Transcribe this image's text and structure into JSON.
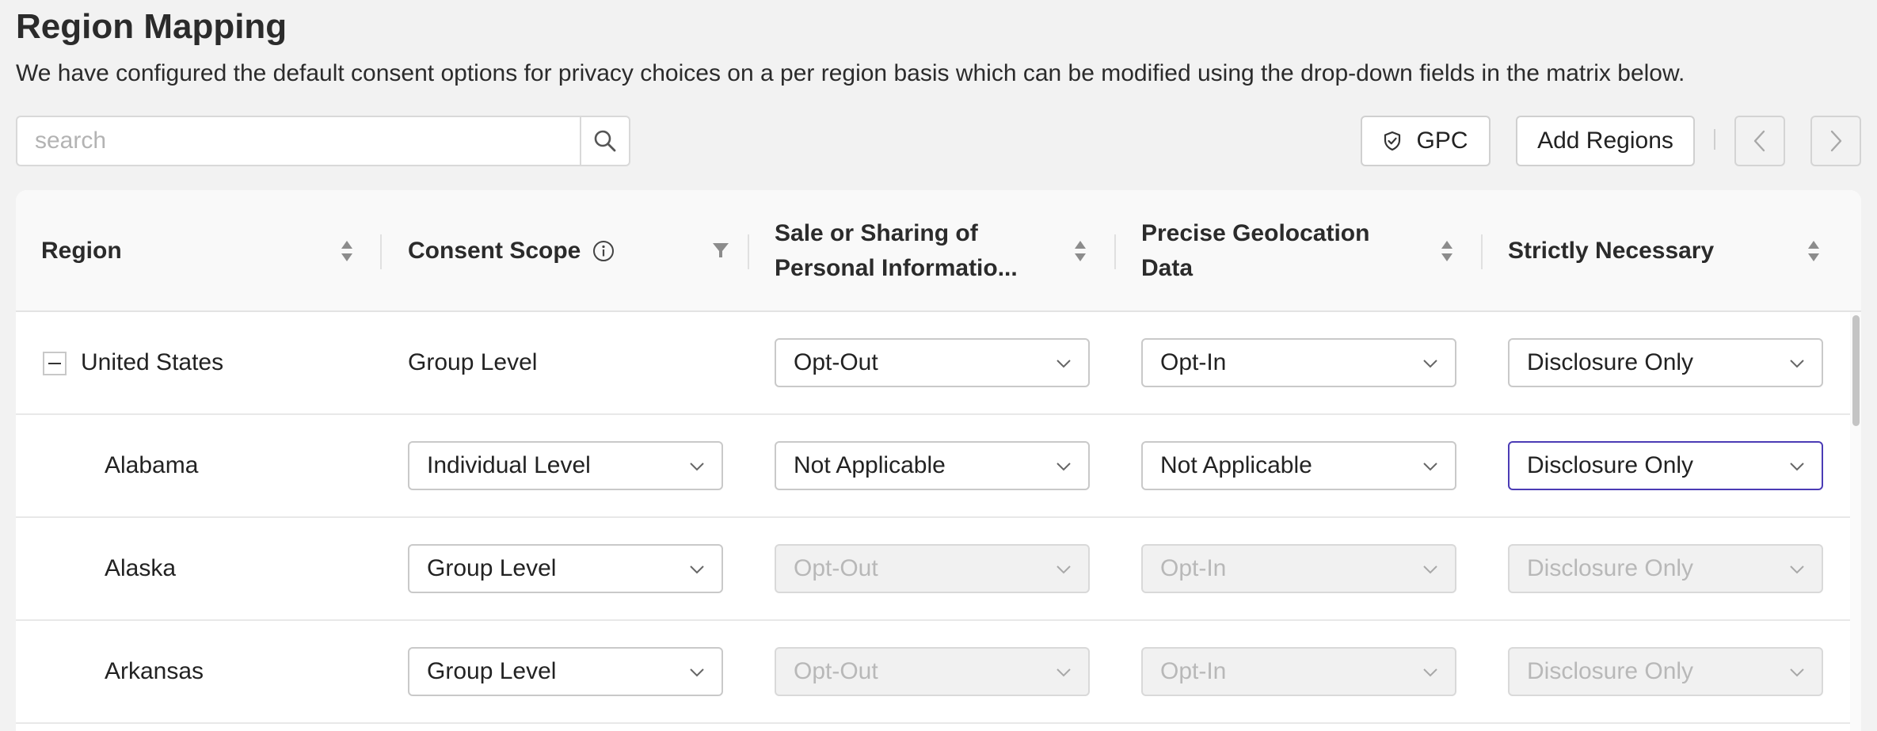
{
  "page": {
    "title": "Region Mapping",
    "description": "We have configured the default consent options for privacy choices on a per region basis which can be modified using the drop-down fields in the matrix below."
  },
  "search": {
    "placeholder": "search",
    "value": ""
  },
  "toolbar": {
    "gpc_label": "GPC",
    "add_regions_label": "Add Regions",
    "prev_icon": "chevron-left-icon",
    "next_icon": "chevron-right-icon"
  },
  "table": {
    "headers": [
      {
        "label": "Region",
        "control": "sort"
      },
      {
        "label": "Consent Scope",
        "control": "filter",
        "info": true
      },
      {
        "label_line1": "Sale or Sharing of",
        "label_line2": "Personal Informatio...",
        "control": "sort"
      },
      {
        "label_line1": "Precise Geolocation",
        "label_line2": "Data",
        "control": "sort"
      },
      {
        "label": "Strictly Necessary",
        "control": "sort"
      }
    ],
    "rows": [
      {
        "region": "United States",
        "expandable": true,
        "scope": "Group Level",
        "scope_is_select": false,
        "sale": "Opt-Out",
        "geo": "Opt-In",
        "necessary": "Disclosure Only",
        "disabled": false
      },
      {
        "region": "Alabama",
        "scope": "Individual Level",
        "scope_is_select": true,
        "sale": "Not Applicable",
        "geo": "Not Applicable",
        "necessary": "Disclosure Only",
        "disabled": false,
        "focused_column": "necessary"
      },
      {
        "region": "Alaska",
        "scope": "Group Level",
        "scope_is_select": true,
        "sale": "Opt-Out",
        "geo": "Opt-In",
        "necessary": "Disclosure Only",
        "disabled": true
      },
      {
        "region": "Arkansas",
        "scope": "Group Level",
        "scope_is_select": true,
        "sale": "Opt-Out",
        "geo": "Opt-In",
        "necessary": "Disclosure Only",
        "disabled": true
      }
    ]
  },
  "colors": {
    "focus_border": "#4b3cb5",
    "disabled_text": "#b8b8b8",
    "disabled_bg": "#f1f1f1"
  }
}
